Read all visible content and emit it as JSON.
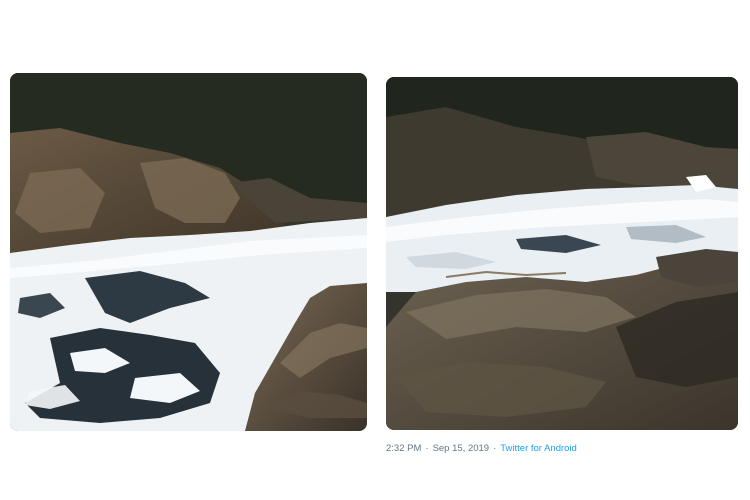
{
  "tweet": {
    "media": [
      {
        "alt": "River covered with white toxic foam between rocks, left view"
      },
      {
        "alt": "River covered with white toxic foam, rocks in foreground, right view"
      }
    ],
    "meta": {
      "time": "2:32 PM",
      "separator": "·",
      "date": "Sep 15, 2019",
      "source": "Twitter for Android"
    }
  },
  "colors": {
    "link": "#1da1f2",
    "meta_text": "#657786",
    "foam": "#f4f7f9",
    "rock": "#5c5245",
    "water": "#2d3a44"
  }
}
